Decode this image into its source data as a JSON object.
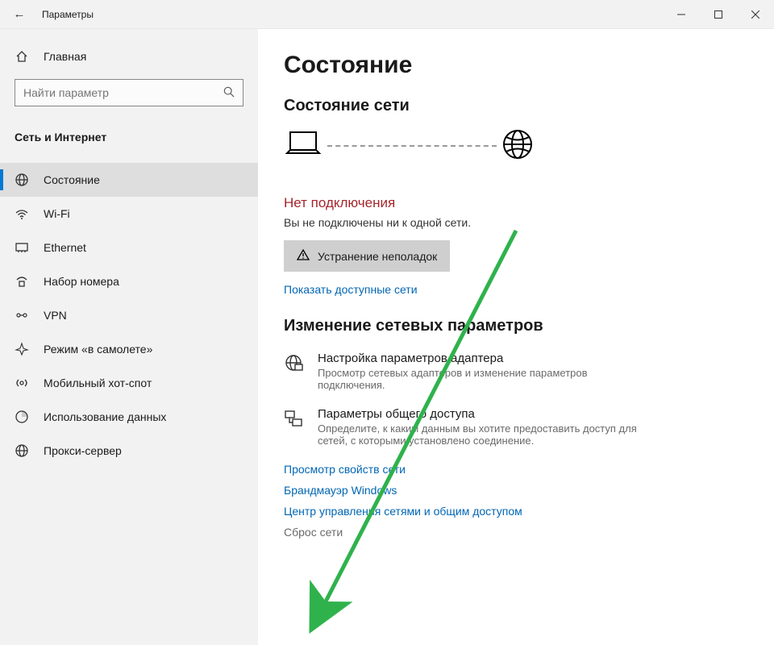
{
  "titlebar": {
    "back_glyph": "←",
    "title": "Параметры"
  },
  "sidebar": {
    "home_label": "Главная",
    "search_placeholder": "Найти параметр",
    "section_label": "Сеть и Интернет",
    "items": [
      {
        "label": "Состояние"
      },
      {
        "label": "Wi-Fi"
      },
      {
        "label": "Ethernet"
      },
      {
        "label": "Набор номера"
      },
      {
        "label": "VPN"
      },
      {
        "label": "Режим «в самолете»"
      },
      {
        "label": "Мобильный хот-спот"
      },
      {
        "label": "Использование данных"
      },
      {
        "label": "Прокси-сервер"
      }
    ]
  },
  "content": {
    "h1": "Состояние",
    "h2_status": "Состояние сети",
    "status_title": "Нет подключения",
    "status_sub": "Вы не подключены ни к одной сети.",
    "troubleshoot_label": "Устранение неполадок",
    "show_networks_label": "Показать доступные сети",
    "h2_change": "Изменение сетевых параметров",
    "opt_adapter_title": "Настройка параметров адаптера",
    "opt_adapter_desc": "Просмотр сетевых адаптеров и изменение параметров подключения.",
    "opt_sharing_title": "Параметры общего доступа",
    "opt_sharing_desc": "Определите, к каким данным вы хотите предоставить доступ для сетей, с которыми установлено соединение.",
    "link_props": "Просмотр свойств сети",
    "link_firewall": "Брандмауэр Windows",
    "link_center": "Центр управления сетями и общим доступом",
    "link_reset": "Сброс сети"
  }
}
